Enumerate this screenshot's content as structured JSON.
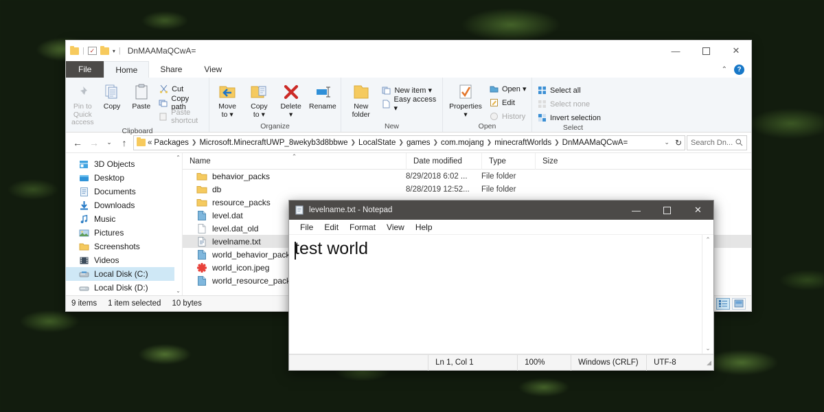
{
  "explorer": {
    "titlebar": {
      "title": "DnMAAMaQCwA=",
      "quick_access_icons": [
        "folder-icon",
        "properties-icon",
        "new-folder-icon",
        "customize-caret-icon"
      ],
      "minimize": "—",
      "maximize": "☐",
      "close": "✕"
    },
    "tabs": [
      {
        "label": "File",
        "kind": "file"
      },
      {
        "label": "Home",
        "kind": "active"
      },
      {
        "label": "Share",
        "kind": "normal"
      },
      {
        "label": "View",
        "kind": "normal"
      }
    ],
    "tab_right": {
      "collapse": "⌃",
      "help": "?"
    },
    "ribbon": {
      "groups": [
        {
          "label": "Clipboard",
          "big": [
            {
              "label": "Pin to Quick\naccess",
              "icon": "pin-icon",
              "dim": true
            },
            {
              "label": "Copy",
              "icon": "copy-icon",
              "dim": false
            },
            {
              "label": "Paste",
              "icon": "paste-icon",
              "dim": false
            }
          ],
          "small": [
            {
              "label": "Cut",
              "icon": "scissors-icon",
              "dim": false
            },
            {
              "label": "Copy path",
              "icon": "copy-path-icon",
              "dim": false
            },
            {
              "label": "Paste shortcut",
              "icon": "paste-shortcut-icon",
              "dim": true
            }
          ]
        },
        {
          "label": "Organize",
          "big": [
            {
              "label": "Move\nto ▾",
              "icon": "move-to-icon",
              "dim": false
            },
            {
              "label": "Copy\nto ▾",
              "icon": "copy-to-icon",
              "dim": false
            },
            {
              "label": "Delete\n▾",
              "icon": "delete-icon",
              "dim": false
            },
            {
              "label": "Rename",
              "icon": "rename-icon",
              "dim": false
            }
          ],
          "small": []
        },
        {
          "label": "New",
          "big": [
            {
              "label": "New\nfolder",
              "icon": "new-folder-icon",
              "dim": false
            }
          ],
          "small": [
            {
              "label": "New item ▾",
              "icon": "new-item-icon",
              "dim": false
            },
            {
              "label": "Easy access ▾",
              "icon": "easy-access-icon",
              "dim": false
            }
          ]
        },
        {
          "label": "Open",
          "big": [
            {
              "label": "Properties\n▾",
              "icon": "properties-icon",
              "dim": false
            }
          ],
          "small": [
            {
              "label": "Open ▾",
              "icon": "open-icon",
              "dim": false
            },
            {
              "label": "Edit",
              "icon": "edit-icon",
              "dim": false
            },
            {
              "label": "History",
              "icon": "history-icon",
              "dim": true
            }
          ]
        },
        {
          "label": "Select",
          "big": [],
          "small": [
            {
              "label": "Select all",
              "icon": "select-all-icon",
              "dim": false
            },
            {
              "label": "Select none",
              "icon": "select-none-icon",
              "dim": true
            },
            {
              "label": "Invert selection",
              "icon": "invert-selection-icon",
              "dim": false
            }
          ]
        }
      ]
    },
    "address": {
      "back": "←",
      "forward": "→",
      "recent": "⌄",
      "up": "↑",
      "prefix": "«",
      "crumbs": [
        "Packages",
        "Microsoft.MinecraftUWP_8wekyb3d8bbwe",
        "LocalState",
        "games",
        "com.mojang",
        "minecraftWorlds",
        "DnMAAMaQCwA="
      ],
      "dropdown": "⌄",
      "refresh": "↻",
      "search_placeholder": "Search Dn...",
      "search_icon": "search-icon"
    },
    "nav_pane": {
      "items": [
        {
          "label": "3D Objects",
          "icon": "3d-objects-icon",
          "selected": false
        },
        {
          "label": "Desktop",
          "icon": "desktop-icon",
          "selected": false
        },
        {
          "label": "Documents",
          "icon": "documents-icon",
          "selected": false
        },
        {
          "label": "Downloads",
          "icon": "downloads-icon",
          "selected": false
        },
        {
          "label": "Music",
          "icon": "music-icon",
          "selected": false
        },
        {
          "label": "Pictures",
          "icon": "pictures-icon",
          "selected": false
        },
        {
          "label": "Screenshots",
          "icon": "folder-icon",
          "selected": false
        },
        {
          "label": "Videos",
          "icon": "videos-icon",
          "selected": false
        },
        {
          "label": "Local Disk (C:)",
          "icon": "system-drive-icon",
          "selected": true
        },
        {
          "label": "Local Disk (D:)",
          "icon": "drive-icon",
          "selected": false
        }
      ],
      "scroll_up": "⌃",
      "scroll_down": "⌄"
    },
    "columns": [
      {
        "label": "Name",
        "sorted": true,
        "sort_glyph": "⌃"
      },
      {
        "label": "Date modified",
        "sorted": false
      },
      {
        "label": "Type",
        "sorted": false
      },
      {
        "label": "Size",
        "sorted": false
      }
    ],
    "files": [
      {
        "name": "behavior_packs",
        "date": "8/29/2018 6:02 ...",
        "type": "File folder",
        "size": "",
        "icon": "folder-icon",
        "selected": false
      },
      {
        "name": "db",
        "date": "8/28/2019 12:52...",
        "type": "File folder",
        "size": "",
        "icon": "folder-icon",
        "selected": false
      },
      {
        "name": "resource_packs",
        "date": "",
        "type": "",
        "size": "",
        "icon": "folder-icon",
        "selected": false
      },
      {
        "name": "level.dat",
        "date": "",
        "type": "",
        "size": "",
        "icon": "dat-file-icon",
        "selected": false
      },
      {
        "name": "level.dat_old",
        "date": "",
        "type": "",
        "size": "",
        "icon": "generic-file-icon",
        "selected": false
      },
      {
        "name": "levelname.txt",
        "date": "",
        "type": "",
        "size": "",
        "icon": "text-file-icon",
        "selected": true
      },
      {
        "name": "world_behavior_packs.js",
        "date": "",
        "type": "",
        "size": "",
        "icon": "dat-file-icon",
        "selected": false
      },
      {
        "name": "world_icon.jpeg",
        "date": "",
        "type": "",
        "size": "",
        "icon": "image-file-icon",
        "selected": false
      },
      {
        "name": "world_resource_packs.js",
        "date": "",
        "type": "",
        "size": "",
        "icon": "dat-file-icon",
        "selected": false
      }
    ],
    "status": {
      "item_count": "9 items",
      "selection": "1 item selected",
      "size": "10 bytes",
      "view_details_icon": "details-view-icon",
      "view_large_icon": "large-icons-view-icon"
    }
  },
  "notepad": {
    "title": "levelname.txt - Notepad",
    "icon": "notepad-icon",
    "window_buttons": {
      "minimize": "—",
      "maximize": "☐",
      "close": "✕"
    },
    "menu": [
      "File",
      "Edit",
      "Format",
      "View",
      "Help"
    ],
    "content": "test world",
    "scroll": {
      "up": "⌃",
      "down": "⌄"
    },
    "status": {
      "position": "Ln 1, Col 1",
      "zoom": "100%",
      "line_ending": "Windows (CRLF)",
      "encoding": "UTF-8"
    }
  },
  "colors": {
    "accent": "#0078d7",
    "selection": "#cfe8f6",
    "titlebar_dark": "#4c4a48",
    "folder_yellow": "#f7ca5d",
    "delete_red": "#cc2b27"
  }
}
